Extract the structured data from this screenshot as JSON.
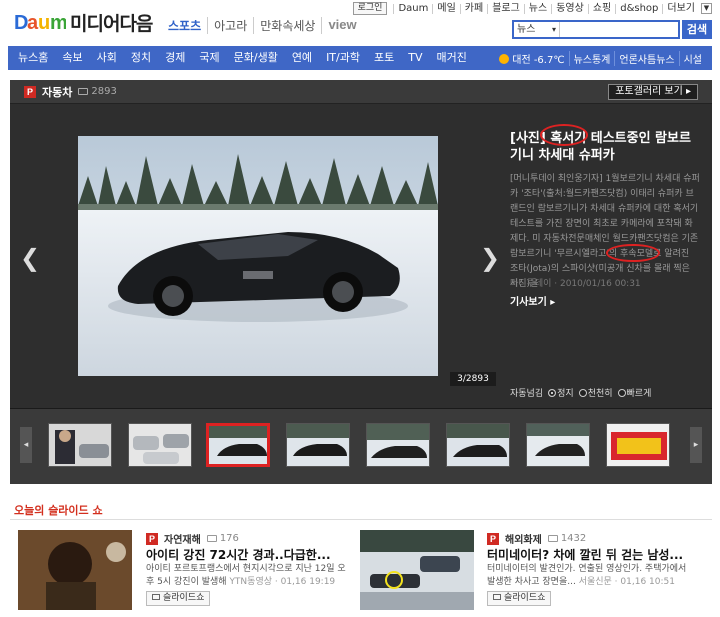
{
  "header": {
    "logo_text": "Daum",
    "brand_name": "미디어다음",
    "services": [
      "스포츠",
      "아고라",
      "만화속세상",
      "view"
    ],
    "login_label": "로그인",
    "util_links": [
      "Daum",
      "메일",
      "카페",
      "블로그",
      "뉴스",
      "동영상",
      "쇼핑",
      "d&shop",
      "더보기"
    ],
    "search": {
      "scope": "뉴스",
      "value": "",
      "button": "검색"
    }
  },
  "nav": {
    "items": [
      "뉴스홈",
      "속보",
      "사회",
      "정치",
      "경제",
      "국제",
      "문화/생활",
      "연예",
      "IT/과학",
      "포토",
      "TV",
      "매거진"
    ],
    "weather": "대전 -6.7℃",
    "right_links": [
      "뉴스통계",
      "언론사틈뉴스",
      "시설"
    ]
  },
  "gallery": {
    "badge": "P",
    "title": "자동차",
    "photo_count": "2893",
    "gallery_button": "포토갤러리 보기 ▸",
    "counter": "3/2893",
    "caption": {
      "title": "[사진] 혹서기 테스트중인 람보르기니 차세대 슈퍼카",
      "body": "[머니투데이 최인웅기자] 1월보르기니 차세대 슈퍼카 '조타'(출처:월드카팬즈닷컴) 이태리 슈퍼카 브랜드인 람보르기니가 차세대 슈퍼카에 대한 혹서기 테스트를 가진 장면이 최초로 카메라에 포착돼 화제다. 미 자동차전문매체인 월드카팬즈닷컴은 기존 람보르기니 '무르시엘라고'의 후속모델로 알려진 조타(Jota)의 스파이샷(미공개 신차를 몰래 찍은 사진)을",
      "source": "머니투데이 · 2010/01/16 00:31",
      "more": "기사보기 ▸"
    },
    "autoplay": {
      "label": "자동넘김",
      "options": [
        "정지",
        "천천히",
        "빠르게"
      ],
      "selected": "정지"
    },
    "thumb_prev": "◂",
    "thumb_next": "▸"
  },
  "slideshow": {
    "section_title": "오늘의 슬라이드 쇼",
    "cards": [
      {
        "badge": "P",
        "category": "자연재해",
        "count": "176",
        "title": "아이티 강진 72시간 경과..다급한...",
        "desc": "아이티 포르토프랭스에서 현지시각으로 지난 12일 오후 5시 강진이 발생해",
        "source": "YTN동영상 · 01,16 19:19",
        "button": "슬라이드쇼"
      },
      {
        "badge": "P",
        "category": "해외화제",
        "count": "1432",
        "title": "터미네이터? 차에 깔린 뒤 걷는 남성...",
        "desc": "터미네이터의 발견인가. 연출된 영상인가. 주택가에서 발생한 차사고 장면을...",
        "source": "서울신문 · 01,16 10:51",
        "button": "슬라이드쇼"
      }
    ]
  }
}
